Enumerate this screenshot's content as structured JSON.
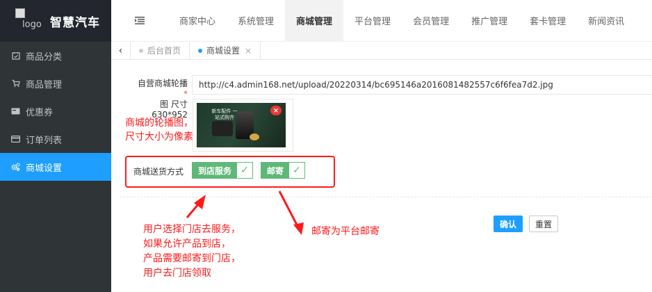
{
  "brand": {
    "logo_alt": "logo",
    "name": "智慧汽车"
  },
  "sidebar": {
    "items": [
      {
        "label": "商品分类",
        "icon": "calendar-check-icon"
      },
      {
        "label": "商品管理",
        "icon": "cart-icon"
      },
      {
        "label": "优惠券",
        "icon": "card-icon"
      },
      {
        "label": "订单列表",
        "icon": "credit-card-icon"
      },
      {
        "label": "商城设置",
        "icon": "gears-icon",
        "active": true
      }
    ]
  },
  "topnav": {
    "toggle_icon": "menu-toggle-icon",
    "tabs": [
      {
        "label": "商家中心"
      },
      {
        "label": "系统管理"
      },
      {
        "label": "商城管理",
        "active": true
      },
      {
        "label": "平台管理"
      },
      {
        "label": "会员管理"
      },
      {
        "label": "推广管理"
      },
      {
        "label": "套卡管理"
      },
      {
        "label": "新闻资讯"
      }
    ]
  },
  "pagetabs": {
    "prev_glyph": "‹",
    "tabs": [
      {
        "label": "后台首页",
        "active": false
      },
      {
        "label": "商城设置",
        "active": true,
        "close": "×"
      }
    ]
  },
  "form": {
    "banner_label": "自营商城轮播图 尺寸630*952",
    "banner_label_parts": [
      "自营商城轮播",
      "图 尺寸",
      "630*952"
    ],
    "required_mark": "*",
    "banner_url": "http://c4.admin168.net/upload/20220314/bc695146a2016081482557c6f6fea7d2.jpg",
    "banner_headline": "新车配件 一站式购齐",
    "remove_glyph": "×",
    "delivery_label": "商城送货方式",
    "delivery_options": [
      {
        "label": "到店服务",
        "checked": true
      },
      {
        "label": "邮寄",
        "checked": true
      }
    ],
    "check_glyph": "✓",
    "confirm_label": "确认",
    "reset_label": "重置"
  },
  "annotations": {
    "size_note": [
      "商城的轮播图，",
      "尺寸大小为像素"
    ],
    "user_note": [
      "用户选择门店去服务，",
      "如果允许产品到店，",
      "产品需要邮寄到门店，",
      "用户去门店领取"
    ],
    "mail_note": "邮寄为平台邮寄"
  },
  "colors": {
    "sidebar_bg": "#2f3437",
    "active_blue": "#1e9fff",
    "check_green": "#5fb878",
    "annotation_red": "#ff1a1a"
  }
}
